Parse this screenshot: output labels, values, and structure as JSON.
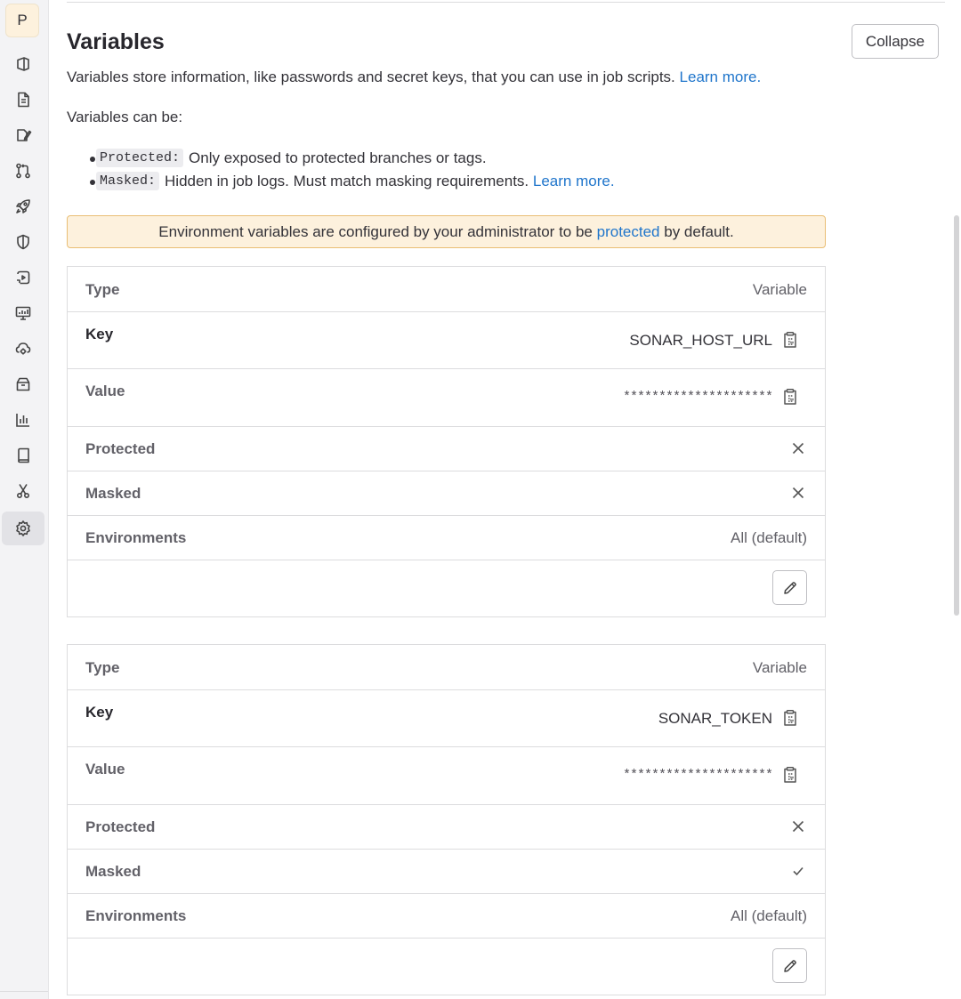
{
  "sidebar": {
    "avatar_letter": "P",
    "items": [
      {
        "icon": "project-overview-icon"
      },
      {
        "icon": "issues-icon"
      },
      {
        "icon": "issue-board-icon"
      },
      {
        "icon": "merge-request-icon"
      },
      {
        "icon": "rocket-icon"
      },
      {
        "icon": "shield-icon"
      },
      {
        "icon": "deployments-icon"
      },
      {
        "icon": "monitor-icon"
      },
      {
        "icon": "cloud-gear-icon"
      },
      {
        "icon": "package-icon"
      },
      {
        "icon": "analytics-icon"
      },
      {
        "icon": "wiki-book-icon"
      },
      {
        "icon": "snippets-scissors-icon"
      },
      {
        "icon": "settings-gear-icon",
        "active": true
      }
    ]
  },
  "section": {
    "title": "Variables",
    "collapse_label": "Collapse",
    "description": "Variables store information, like passwords and secret keys, that you can use in job scripts.",
    "description_link": "Learn more.",
    "can_be_label": "Variables can be:",
    "bullets": [
      {
        "code": "Protected:",
        "text": "Only exposed to protected branches or tags.",
        "link": ""
      },
      {
        "code": "Masked:",
        "text": "Hidden in job logs. Must match masking requirements.",
        "link": "Learn more."
      }
    ],
    "alert": {
      "text_before": "Environment variables are configured by your administrator to be",
      "link": "protected",
      "text_after": "by default."
    }
  },
  "labels": {
    "type": "Type",
    "key": "Key",
    "value": "Value",
    "protected": "Protected",
    "masked": "Masked",
    "environments": "Environments"
  },
  "variables": [
    {
      "type": "Variable",
      "key": "SONAR_HOST_URL",
      "value": "*********************",
      "protected": false,
      "masked": false,
      "environments": "All (default)"
    },
    {
      "type": "Variable",
      "key": "SONAR_TOKEN",
      "value": "*********************",
      "protected": false,
      "masked": true,
      "environments": "All (default)"
    }
  ],
  "colors": {
    "link": "#1f75cb",
    "alert_bg": "#fdf1dd",
    "alert_border": "#e9be74",
    "sidebar_bg": "#f3f3f5"
  }
}
